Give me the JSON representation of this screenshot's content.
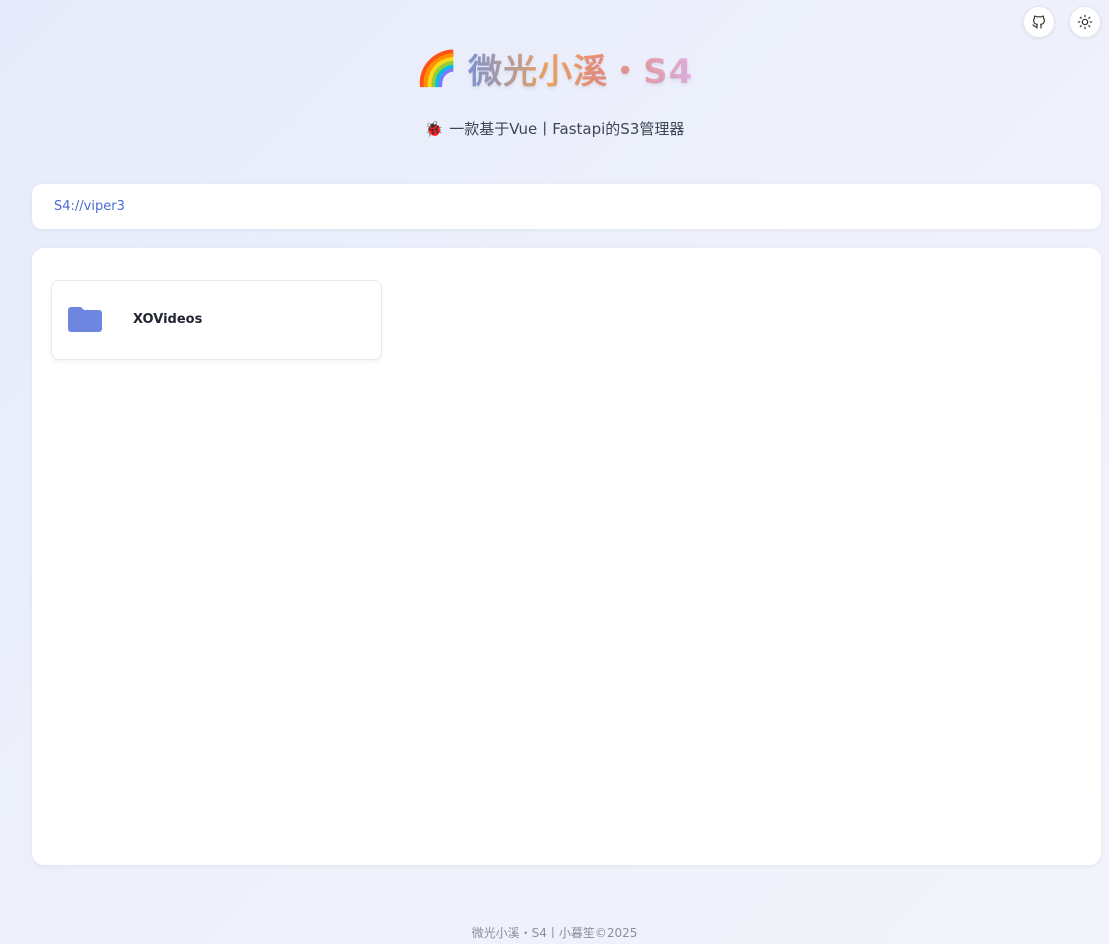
{
  "header": {
    "title_emoji": "🌈",
    "title": "微光小溪・S4",
    "subtitle_emoji": "🐞",
    "subtitle": "一款基于Vue丨Fastapi的S3管理器",
    "actions": [
      {
        "icon": "github-icon"
      },
      {
        "icon": "sun-icon"
      }
    ]
  },
  "breadcrumb": {
    "path": "S4://viper3"
  },
  "files": [
    {
      "name": "XOVideos",
      "type": "folder",
      "icon": "folder-icon",
      "icon_color": "#6f86e0"
    }
  ],
  "footer": {
    "text": "微光小溪・S4丨小暮笙©2025"
  },
  "colors": {
    "accent": "#4b6bd6",
    "folder": "#6f86e0",
    "background": "#e9edfb"
  }
}
